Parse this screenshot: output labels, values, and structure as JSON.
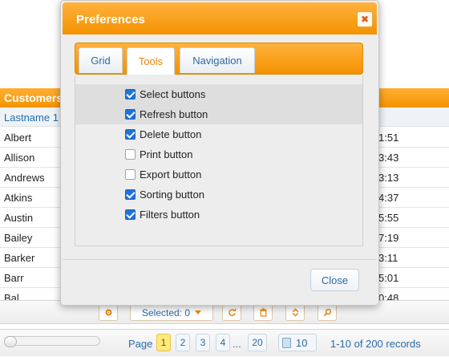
{
  "grid": {
    "title": "Customers",
    "column_header": "Lastname 1",
    "rows": [
      {
        "lastname": "Albert",
        "time": "1:51"
      },
      {
        "lastname": "Allison",
        "time": "3:43"
      },
      {
        "lastname": "Andrews",
        "time": "3:13"
      },
      {
        "lastname": "Atkins",
        "time": "4:37"
      },
      {
        "lastname": "Austin",
        "time": "5:55"
      },
      {
        "lastname": "Bailey",
        "time": "7:19"
      },
      {
        "lastname": "Barker",
        "time": "3:11"
      },
      {
        "lastname": "Barr",
        "time": "5:01"
      },
      {
        "lastname": "Bal",
        "time": "0:48"
      }
    ]
  },
  "toolbar": {
    "selected_label": "Selected: 0"
  },
  "pager": {
    "page_label": "Page",
    "pages": [
      "1",
      "2",
      "3",
      "4"
    ],
    "dots": "...",
    "last_page": "20",
    "page_size": "10",
    "records": "1-10 of 200 records"
  },
  "dialog": {
    "title": "Preferences",
    "close_glyph": "✖",
    "tabs": [
      "Grid",
      "Tools",
      "Navigation"
    ],
    "active_tab": "Tools",
    "options": [
      {
        "label": "Select buttons",
        "checked": true
      },
      {
        "label": "Refresh button",
        "checked": true
      },
      {
        "label": "Delete button",
        "checked": true
      },
      {
        "label": "Print button",
        "checked": false
      },
      {
        "label": "Export button",
        "checked": false
      },
      {
        "label": "Sorting button",
        "checked": true
      },
      {
        "label": "Filters button",
        "checked": true
      }
    ],
    "close_button": "Close"
  },
  "colors": {
    "accent": "#f39200",
    "link": "#2b6aa8",
    "checkbox": "#1f73d9"
  }
}
